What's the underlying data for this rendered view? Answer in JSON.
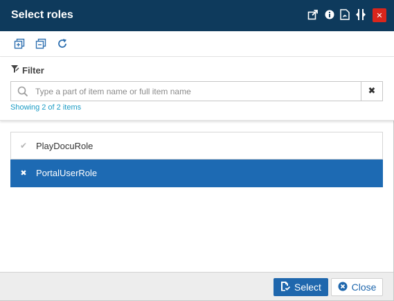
{
  "window": {
    "title": "Select roles",
    "title_icons": [
      "open-external-icon",
      "info-icon",
      "pdf-icon",
      "resize-icon",
      "close-icon"
    ],
    "close_glyph": "✕"
  },
  "toolbar": {
    "icons": [
      "expand-all-icon",
      "collapse-all-icon",
      "refresh-icon"
    ]
  },
  "filter": {
    "label": "Filter",
    "placeholder": "Type a part of item name or full item name",
    "value": "",
    "clear_glyph": "✖",
    "status": "Showing 2 of 2 items"
  },
  "items": [
    {
      "label": "PlayDocuRole",
      "mark": "✔",
      "selected": false
    },
    {
      "label": "PortalUserRole",
      "mark": "✖",
      "selected": true
    }
  ],
  "footer": {
    "select_label": "Select",
    "close_label": "Close"
  },
  "colors": {
    "titlebar": "#0e3a5c",
    "accent": "#1f67ad",
    "selected_row": "#1d6ab3",
    "close_red": "#d9261c",
    "status_text": "#1a9bc4"
  }
}
